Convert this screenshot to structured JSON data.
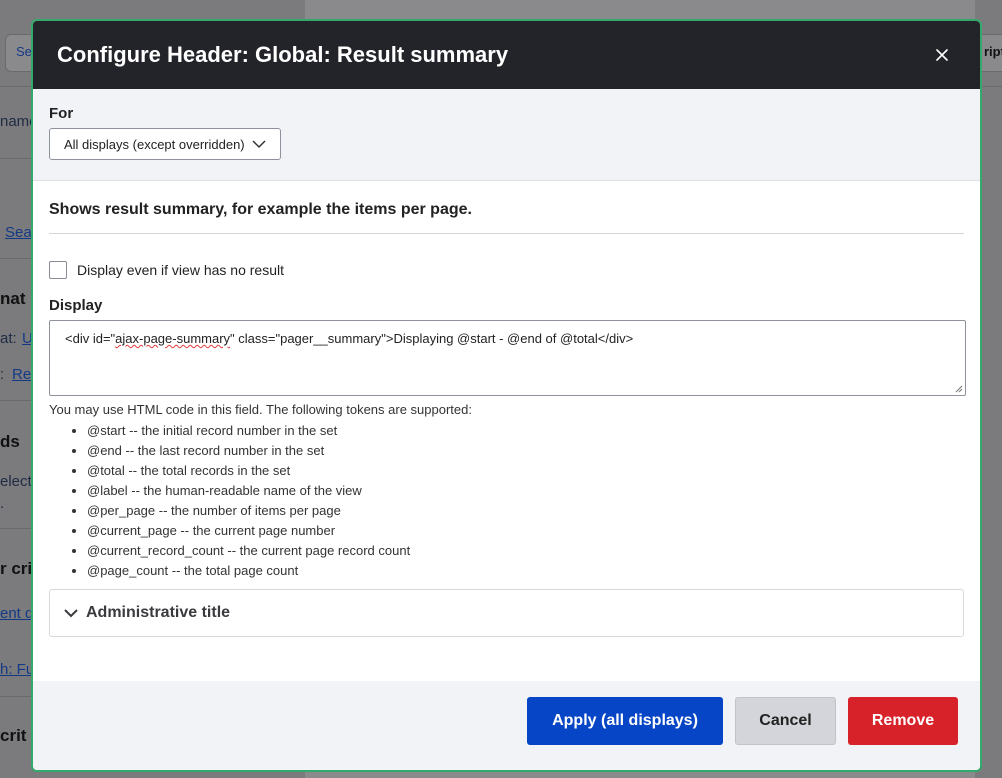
{
  "background": {
    "search_btn": "Se",
    "right_btn": "ript",
    "frag_name": "name",
    "search_link": "Sea",
    "frag_mat": "nat",
    "frag_at": "at:",
    "link_u": "U",
    "frag_colon": ":",
    "link_re": "Re",
    "frag_ds": "ds",
    "frag_elect": "elect",
    "frag_dot": ".",
    "frag_crit1": "r crit",
    "link_entd": "ent d",
    "link_hfu": "h: Fu",
    "frag_crit2": "crit"
  },
  "modal": {
    "title": "Configure Header: Global: Result summary",
    "for_label": "For",
    "for_select_value": "All displays (except overridden)",
    "description": "Shows result summary, for example the items per page.",
    "checkbox_label": "Display even if view has no result",
    "display_label": "Display",
    "display_value_pre": "<div id=\"",
    "display_value_squiggle": "ajax-page-summary",
    "display_value_post": "\" class=\"pager__summary\">Displaying @start - @end of @total</div>",
    "help_text": "You may use HTML code in this field. The following tokens are supported:",
    "tokens": [
      "@start -- the initial record number in the set",
      "@end -- the last record number in the set",
      "@total -- the total records in the set",
      "@label -- the human-readable name of the view",
      "@per_page -- the number of items per page",
      "@current_page -- the current page number",
      "@current_record_count -- the current page record count",
      "@page_count -- the total page count"
    ],
    "details_title": "Administrative title",
    "buttons": {
      "apply": "Apply (all displays)",
      "cancel": "Cancel",
      "remove": "Remove"
    }
  },
  "icons": [
    "close-icon",
    "chevron-down-icon",
    "resize-handle-icon"
  ],
  "colors": {
    "header_bg": "#232429",
    "modal_border": "#35a86b",
    "apply": "#0645c6",
    "remove": "#d8222a",
    "cancel": "#d4d5da"
  }
}
